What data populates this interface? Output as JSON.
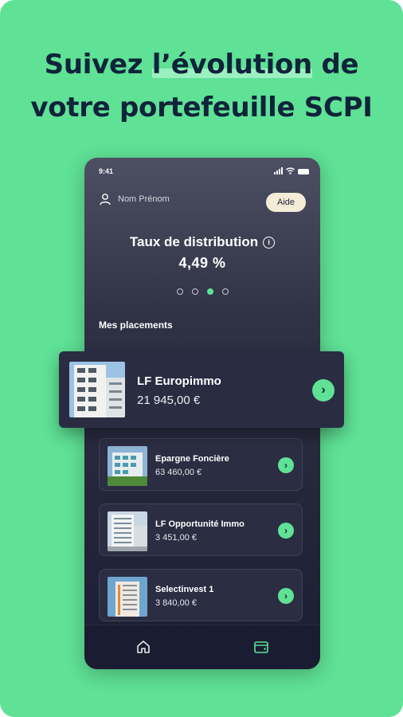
{
  "headline": {
    "line1_prefix": "Suivez ",
    "line1_highlight": "l’évolution",
    "line1_suffix": " de",
    "line2": "votre portefeuille SCPI"
  },
  "colors": {
    "background": "#5fe196",
    "accent": "#5fe196",
    "phone_dark": "#232539"
  },
  "phone": {
    "status_time": "9:41",
    "user_name": "Nom Prénom",
    "help_button": "Aide",
    "distribution_title": "Taux de distribution",
    "distribution_value": "4,49 %",
    "carousel_active_index": 3,
    "carousel_total": 4,
    "section_title": "Mes placements",
    "placements": [
      {
        "name": "Epargne Foncière",
        "amount": "63 460,00 €"
      },
      {
        "name": "LF Opportunité Immo",
        "amount": "3 451,00 €"
      },
      {
        "name": "Selectinvest 1",
        "amount": "3 840,00 €"
      }
    ],
    "nav": [
      "home-icon",
      "wallet-icon"
    ]
  },
  "featured_card": {
    "name": "LF Europimmo",
    "amount": "21 945,00 €"
  }
}
